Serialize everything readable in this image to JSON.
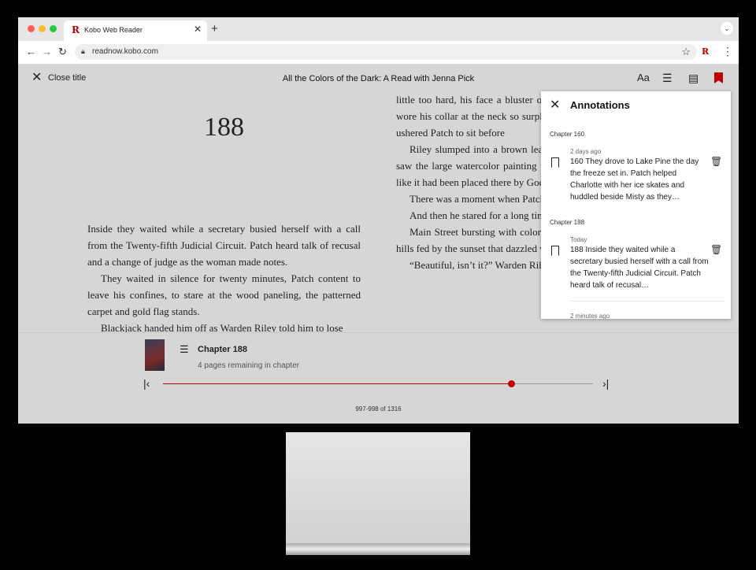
{
  "browser": {
    "tab_title": "Kobo Web Reader",
    "tab_logo": "R",
    "new_tab": "+",
    "url": "readnow.kobo.com",
    "extension_logo": "R"
  },
  "toolbar": {
    "close_label": "Close title",
    "book_title": "All the Colors of the Dark: A Read with Jenna Pick",
    "font_icon": "Aa"
  },
  "page_left": {
    "chapter_number": "188",
    "paragraphs": [
      "Inside they waited while a secretary busied herself with a call from the Twenty-fifth Judicial Circuit. Patch heard talk of recusal and a change of judge as the woman made notes.",
      "They waited in silence for twenty minutes, Patch content to leave his confines, to stare at the wood paneling, the patterned carpet and gold flag stands.",
      "Blackjack handed him off as Warden Riley told him to lose"
    ]
  },
  "page_right": {
    "paragraphs": [
      "little too hard, his face a bluster of eyes, and shaving nicks. He wore his collar at the neck so surplus flesh spilled. He tube as he ushered Patch to sit before",
      "Riley slumped into a brown leather chair and pull it in Patch saw the large watercolor painting that hung in the center behind like it had been placed there by God",
      "There was a moment when Patch had been pulled on him.",
      "And then he stared for a long time at",
      "Main Street bursting with color on one side, a vista of rolling hills fed by the sunset that dazzled with two dozen",
      "“Beautiful, isn’t it?” Warden Riley said, turning to look"
    ]
  },
  "footer": {
    "chapter_label": "Chapter 188",
    "remaining": "4 pages remaining in chapter",
    "page_range": "997-998 of 1316",
    "progress_fraction": 0.81
  },
  "annotations": {
    "title": "Annotations",
    "groups": [
      {
        "chapter": "Chapter 160",
        "when": "2 days ago",
        "text": "160 They drove to Lake Pine the day the freeze set in. Patch helped Charlotte with her ice skates and huddled beside Misty as they…"
      },
      {
        "chapter": "Chapter 188",
        "when": "Today",
        "text": "188 Inside they waited while a secretary busied herself with a call from the Twenty-fifth Judicial Circuit. Patch heard talk of recusal…"
      },
      {
        "chapter": "",
        "when": "2 minutes ago",
        "text": ""
      }
    ]
  },
  "colors": {
    "accent": "#bf0000",
    "reader_bg": "#d6d6d6"
  }
}
